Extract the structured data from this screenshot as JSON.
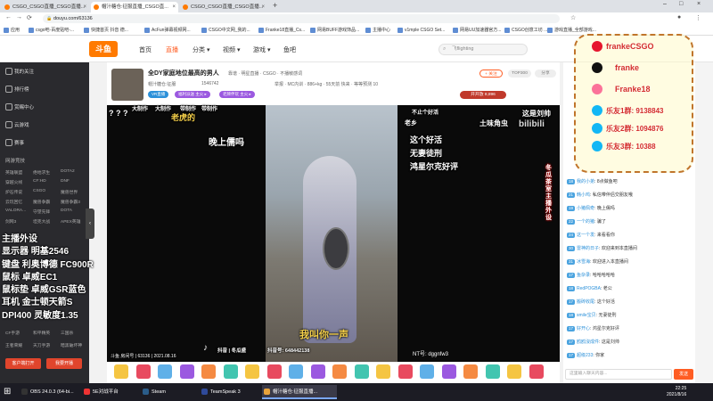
{
  "browser": {
    "tabs": [
      {
        "title": "CSGO_CSGO直播_CSGO直播...",
        "active": false
      },
      {
        "title": "帽汁糖仓:征服直播_CSGO直...",
        "active": true
      },
      {
        "title": "CSGO_CSGO直播_CSGO直播...",
        "active": false
      }
    ],
    "url": "douyu.com/63136",
    "bookmarks": [
      "应用",
      "csgo吧-百度贴吧-...",
      "快捷首页 抖音 德...",
      "AcFun弹幕视频网...",
      "CSGO中文网_我的...",
      "Franke18直播_Cs...",
      "网易BUFF游戏饰品...",
      "主播中心",
      "v1mple CSGO Set...",
      "网易UU加速器官方...",
      "CSGO创意工坊 ...",
      "游戏直播_全部游戏..."
    ],
    "new_tab": "+"
  },
  "site": {
    "logo": "斗鱼",
    "nav": [
      {
        "label": "首页",
        "active": false
      },
      {
        "label": "直播",
        "active": true
      },
      {
        "label": "分类 ▾",
        "active": false
      },
      {
        "label": "视频 ▾",
        "active": false
      },
      {
        "label": "游戏 ▾",
        "active": false
      },
      {
        "label": "鱼吧",
        "active": false
      }
    ],
    "search_placeholder": "飞flighting"
  },
  "sidebar": {
    "items": [
      "我的关注",
      "排行榜",
      "赏赐中心",
      "云游戏",
      "赛事"
    ],
    "section_title": "网游竞技",
    "grid": [
      "英雄联盟",
      "绝地求生",
      "DOTA2",
      "穿越火线",
      "CF:HD",
      "DNF",
      "炉石传说",
      "CSGO",
      "魔兽世界",
      "云玩回忆",
      "魔兽争霸",
      "魔兽争霸3",
      "VALORA...",
      "守望先锋",
      "DOTA",
      "剑网3",
      "坦克大战",
      "APEX英雄",
      "CF手游",
      "和平精英",
      "三国杀",
      "王者荣耀",
      "天刀手游",
      "暗黑破坏神"
    ],
    "buttons": [
      "客户端打开",
      "我要开播"
    ]
  },
  "overlay_left": [
    "主播外设",
    "显示器  明基2546",
    "键盘  利奥博德 FC900R",
    "鼠标  卓威EC1",
    "鼠标垫  卓威GSR蓝色",
    "耳机  金士顿天箭S",
    "DPI400  灵敏度1.35"
  ],
  "room": {
    "title": "全DY家庭地位最高的男人",
    "tags": [
      "靠谱",
      "明星直播",
      "CSGO",
      "不播敏感词"
    ],
    "streamer": "帽汁糖仓:征服",
    "followers": "1546742",
    "meta": [
      "举报",
      "MC内训",
      "886+kg",
      "55天前 快来",
      "等等预测 10"
    ],
    "badges": [
      "VR直播",
      "福利派送 主火 ▸",
      "老牌伴玩 主火 ▸"
    ],
    "follow_btn": "+ 关注",
    "rank_btn": "TOP300",
    "share_btn": "分享",
    "hot_btn": "开开放 8,896"
  },
  "video": {
    "captions": [
      "大制作",
      "大制作",
      "带制作",
      "带制作",
      "这个好活",
      "这是刘帅",
      "土味角虫",
      "bilibili",
      "老虎的",
      "不止个好活",
      "老乡",
      "这个好活",
      "无妻徒刑",
      "鸿星尔克好评",
      "晚上儒吗",
      "我叫你一声",
      "冬瓜茶室主播外设"
    ],
    "tiktok": "抖音 | 冬瓜盛",
    "overlay_id": "抖音号: 648442138",
    "ntkey": "NT号: dggnfw3",
    "status": "斗鱼 房间号 | 63136 | 2021.08.16",
    "time": "2021.08.16"
  },
  "chat": {
    "lines": [
      {
        "lv": "18",
        "nick": "我的小弟",
        "text": "8点做鱼吧"
      },
      {
        "lv": "21",
        "nick": "韩小鸡",
        "text": "私信带伴侣交朋友哦"
      },
      {
        "lv": "19",
        "nick": "小猪佩奇",
        "text": "晚上儒吗"
      },
      {
        "lv": "22",
        "nick": "一个的猪",
        "text": "骗了"
      },
      {
        "lv": "24",
        "nick": "这一个发",
        "text": "来看看你"
      },
      {
        "lv": "30",
        "nick": "雷神的日子",
        "text": "欢迎来到本直播间"
      },
      {
        "lv": "31",
        "nick": "冰雪海",
        "text": "欢迎进入本直播间"
      },
      {
        "lv": "17",
        "nick": "鱼杂录",
        "text": "哈哈哈哈哈"
      },
      {
        "lv": "18",
        "nick": "RedPOGBA",
        "text": "老公"
      },
      {
        "lv": "17",
        "nick": "搬砖收尾",
        "text": "这个好活"
      },
      {
        "lv": "18",
        "nick": "smile宝贝",
        "text": "无妻徒刑"
      },
      {
        "lv": "17",
        "nick": "好开心",
        "text": "鸿星尔克好评"
      },
      {
        "lv": "17",
        "nick": "鸥鸥沒成件",
        "text": "这是刘帅"
      },
      {
        "lv": "17",
        "nick": "超级233",
        "text": "你家"
      }
    ],
    "input_placeholder": "这里输入聊天内容...",
    "send": "发送"
  },
  "social": {
    "lines": [
      "frankeCSGO",
      "franke",
      "Franke18",
      "乐友1群: 9138843",
      "乐友2群: 1094876",
      "乐友3群: 10388"
    ]
  },
  "taskbar": {
    "items": [
      {
        "label": "OBS 24.0.3 (64-bi...",
        "active": false,
        "color": "#333"
      },
      {
        "label": "5E对战平台",
        "active": false,
        "color": "#e33"
      },
      {
        "label": "Steam",
        "active": false,
        "color": "#2b5d8a"
      },
      {
        "label": "TeamSpeak 3",
        "active": false,
        "color": "#2f4a9a"
      },
      {
        "label": "帽汁糖仓:征服直播...",
        "active": true,
        "color": "#e8a33b"
      }
    ],
    "time": "22:25",
    "date": "2021/8/16"
  },
  "colors": {
    "accent": "#ff5d23",
    "sidebar": "#2a2a2e",
    "video_text": "#ffffff"
  }
}
